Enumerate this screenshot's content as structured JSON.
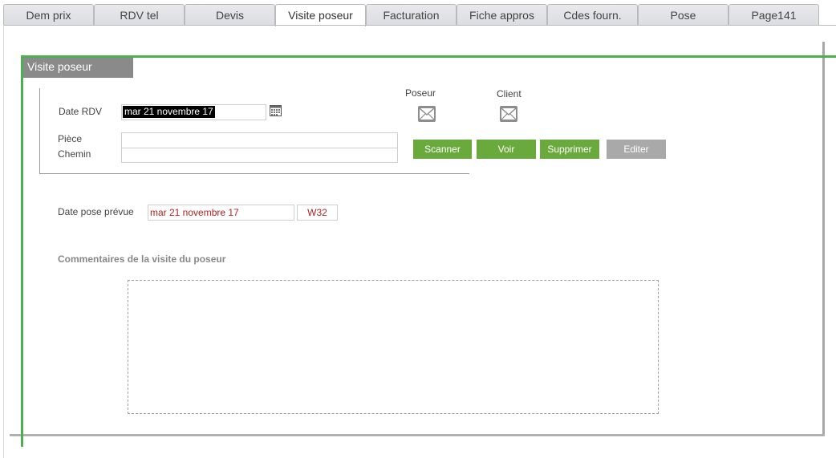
{
  "tabs": [
    {
      "label": "Dem prix",
      "active": false
    },
    {
      "label": "RDV tel",
      "active": false
    },
    {
      "label": "Devis",
      "active": false
    },
    {
      "label": "Visite poseur",
      "active": true
    },
    {
      "label": "Facturation",
      "active": false
    },
    {
      "label": "Fiche appros",
      "active": false
    },
    {
      "label": "Cdes fourn.",
      "active": false
    },
    {
      "label": "Pose",
      "active": false
    },
    {
      "label": "Page141",
      "active": false
    }
  ],
  "section": {
    "title": "Visite poseur"
  },
  "rdv": {
    "date_label": "Date RDV",
    "date_value": "mar 21 novembre 17",
    "calendar_icon": "calendar-icon"
  },
  "attachment": {
    "piece_label": "Pièce",
    "chemin_label": "Chemin",
    "piece_value": "",
    "chemin_value": ""
  },
  "mail": {
    "poseur_label": "Poseur",
    "client_label": "Client",
    "icon": "envelope-icon"
  },
  "buttons": {
    "scanner": "Scanner",
    "voir": "Voir",
    "supprimer": "Supprimer",
    "editer": "Editer"
  },
  "pose": {
    "label": "Date pose prévue",
    "date_value": "mar 21 novembre 17",
    "week_value": "W32"
  },
  "comments": {
    "title": "Commentaires de la visite du poseur",
    "value": ""
  },
  "colors": {
    "accent_green": "#4caf50",
    "button_green": "#6aaa3c",
    "button_gray": "#a9a9a9",
    "section_header": "#8a8a8a",
    "date_red": "#b22222"
  }
}
